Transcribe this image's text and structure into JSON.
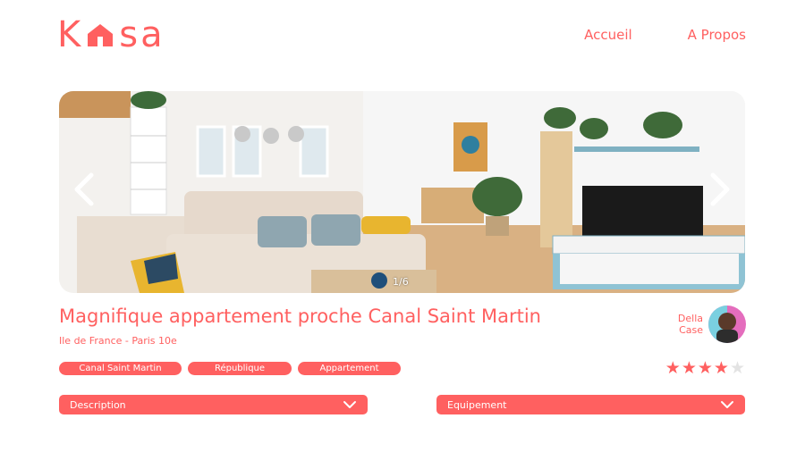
{
  "header": {
    "logo_letters": [
      "K",
      "s",
      "a"
    ],
    "nav": [
      {
        "label": "Accueil"
      },
      {
        "label": "A Propos"
      }
    ]
  },
  "carousel": {
    "counter": "1/6"
  },
  "listing": {
    "title": "Magnifique appartement proche Canal Saint Martin",
    "location": "Ile de France - Paris 10e",
    "host_first": "Della",
    "host_last": "Case",
    "tags": [
      "Canal Saint Martin",
      "République",
      "Appartement"
    ],
    "rating": 4,
    "rating_max": 5
  },
  "collapses": {
    "description_label": "Description",
    "equipment_label": "Equipement"
  },
  "colors": {
    "accent": "#ff6060",
    "star_empty": "#e3e3e3"
  }
}
